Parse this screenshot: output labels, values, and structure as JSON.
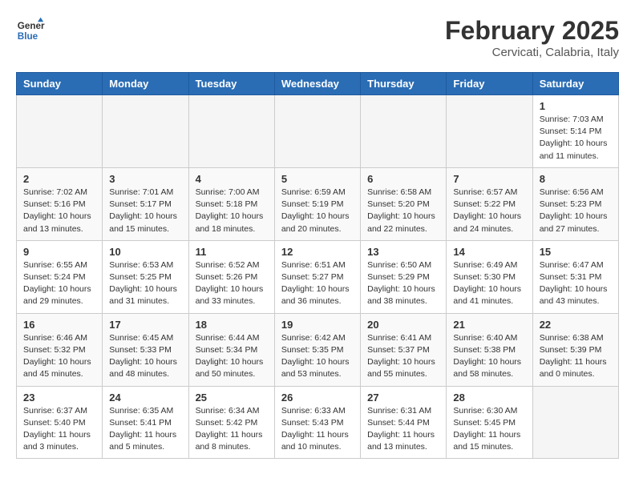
{
  "header": {
    "logo_general": "General",
    "logo_blue": "Blue",
    "month_year": "February 2025",
    "location": "Cervicati, Calabria, Italy"
  },
  "weekdays": [
    "Sunday",
    "Monday",
    "Tuesday",
    "Wednesday",
    "Thursday",
    "Friday",
    "Saturday"
  ],
  "weeks": [
    [
      {
        "day": "",
        "info": ""
      },
      {
        "day": "",
        "info": ""
      },
      {
        "day": "",
        "info": ""
      },
      {
        "day": "",
        "info": ""
      },
      {
        "day": "",
        "info": ""
      },
      {
        "day": "",
        "info": ""
      },
      {
        "day": "1",
        "info": "Sunrise: 7:03 AM\nSunset: 5:14 PM\nDaylight: 10 hours\nand 11 minutes."
      }
    ],
    [
      {
        "day": "2",
        "info": "Sunrise: 7:02 AM\nSunset: 5:16 PM\nDaylight: 10 hours\nand 13 minutes."
      },
      {
        "day": "3",
        "info": "Sunrise: 7:01 AM\nSunset: 5:17 PM\nDaylight: 10 hours\nand 15 minutes."
      },
      {
        "day": "4",
        "info": "Sunrise: 7:00 AM\nSunset: 5:18 PM\nDaylight: 10 hours\nand 18 minutes."
      },
      {
        "day": "5",
        "info": "Sunrise: 6:59 AM\nSunset: 5:19 PM\nDaylight: 10 hours\nand 20 minutes."
      },
      {
        "day": "6",
        "info": "Sunrise: 6:58 AM\nSunset: 5:20 PM\nDaylight: 10 hours\nand 22 minutes."
      },
      {
        "day": "7",
        "info": "Sunrise: 6:57 AM\nSunset: 5:22 PM\nDaylight: 10 hours\nand 24 minutes."
      },
      {
        "day": "8",
        "info": "Sunrise: 6:56 AM\nSunset: 5:23 PM\nDaylight: 10 hours\nand 27 minutes."
      }
    ],
    [
      {
        "day": "9",
        "info": "Sunrise: 6:55 AM\nSunset: 5:24 PM\nDaylight: 10 hours\nand 29 minutes."
      },
      {
        "day": "10",
        "info": "Sunrise: 6:53 AM\nSunset: 5:25 PM\nDaylight: 10 hours\nand 31 minutes."
      },
      {
        "day": "11",
        "info": "Sunrise: 6:52 AM\nSunset: 5:26 PM\nDaylight: 10 hours\nand 33 minutes."
      },
      {
        "day": "12",
        "info": "Sunrise: 6:51 AM\nSunset: 5:27 PM\nDaylight: 10 hours\nand 36 minutes."
      },
      {
        "day": "13",
        "info": "Sunrise: 6:50 AM\nSunset: 5:29 PM\nDaylight: 10 hours\nand 38 minutes."
      },
      {
        "day": "14",
        "info": "Sunrise: 6:49 AM\nSunset: 5:30 PM\nDaylight: 10 hours\nand 41 minutes."
      },
      {
        "day": "15",
        "info": "Sunrise: 6:47 AM\nSunset: 5:31 PM\nDaylight: 10 hours\nand 43 minutes."
      }
    ],
    [
      {
        "day": "16",
        "info": "Sunrise: 6:46 AM\nSunset: 5:32 PM\nDaylight: 10 hours\nand 45 minutes."
      },
      {
        "day": "17",
        "info": "Sunrise: 6:45 AM\nSunset: 5:33 PM\nDaylight: 10 hours\nand 48 minutes."
      },
      {
        "day": "18",
        "info": "Sunrise: 6:44 AM\nSunset: 5:34 PM\nDaylight: 10 hours\nand 50 minutes."
      },
      {
        "day": "19",
        "info": "Sunrise: 6:42 AM\nSunset: 5:35 PM\nDaylight: 10 hours\nand 53 minutes."
      },
      {
        "day": "20",
        "info": "Sunrise: 6:41 AM\nSunset: 5:37 PM\nDaylight: 10 hours\nand 55 minutes."
      },
      {
        "day": "21",
        "info": "Sunrise: 6:40 AM\nSunset: 5:38 PM\nDaylight: 10 hours\nand 58 minutes."
      },
      {
        "day": "22",
        "info": "Sunrise: 6:38 AM\nSunset: 5:39 PM\nDaylight: 11 hours\nand 0 minutes."
      }
    ],
    [
      {
        "day": "23",
        "info": "Sunrise: 6:37 AM\nSunset: 5:40 PM\nDaylight: 11 hours\nand 3 minutes."
      },
      {
        "day": "24",
        "info": "Sunrise: 6:35 AM\nSunset: 5:41 PM\nDaylight: 11 hours\nand 5 minutes."
      },
      {
        "day": "25",
        "info": "Sunrise: 6:34 AM\nSunset: 5:42 PM\nDaylight: 11 hours\nand 8 minutes."
      },
      {
        "day": "26",
        "info": "Sunrise: 6:33 AM\nSunset: 5:43 PM\nDaylight: 11 hours\nand 10 minutes."
      },
      {
        "day": "27",
        "info": "Sunrise: 6:31 AM\nSunset: 5:44 PM\nDaylight: 11 hours\nand 13 minutes."
      },
      {
        "day": "28",
        "info": "Sunrise: 6:30 AM\nSunset: 5:45 PM\nDaylight: 11 hours\nand 15 minutes."
      },
      {
        "day": "",
        "info": ""
      }
    ]
  ]
}
